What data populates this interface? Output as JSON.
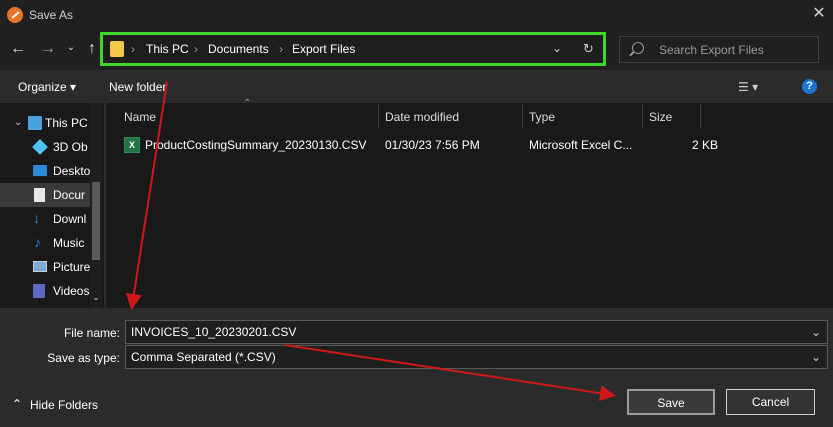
{
  "window": {
    "title": "Save As"
  },
  "address": {
    "crumbs": [
      "This PC",
      "Documents",
      "Export Files"
    ]
  },
  "search": {
    "placeholder": "Search Export Files"
  },
  "toolbar": {
    "organize": "Organize ▾",
    "new_folder": "New folder",
    "help": "?"
  },
  "sidebar": {
    "items": [
      {
        "label": "This PC",
        "icon": "pc-icon"
      },
      {
        "label": "3D Ob",
        "icon": "cube-icon"
      },
      {
        "label": "Deskto",
        "icon": "desktop-icon"
      },
      {
        "label": "Docur",
        "icon": "document-icon"
      },
      {
        "label": "Downl",
        "icon": "download-icon"
      },
      {
        "label": "Music",
        "icon": "music-icon"
      },
      {
        "label": "Picture",
        "icon": "picture-icon"
      },
      {
        "label": "Videos",
        "icon": "video-icon"
      }
    ]
  },
  "files": {
    "columns": [
      "Name",
      "Date modified",
      "Type",
      "Size"
    ],
    "rows": [
      {
        "name": "ProductCostingSummary_20230130.CSV",
        "date": "01/30/23 7:56 PM",
        "type": "Microsoft Excel C...",
        "size": "2 KB"
      }
    ]
  },
  "form": {
    "file_name_label": "File name:",
    "file_name_value": "INVOICES_10_20230201.CSV",
    "type_label": "Save as type:",
    "type_value": "Comma Separated (*.CSV)"
  },
  "buttons": {
    "save": "Save",
    "cancel": "Cancel",
    "hide_folders": "Hide Folders"
  },
  "colors": {
    "highlight_box": "#3fd62c",
    "arrow": "#d01818",
    "help": "#1e74d2"
  }
}
